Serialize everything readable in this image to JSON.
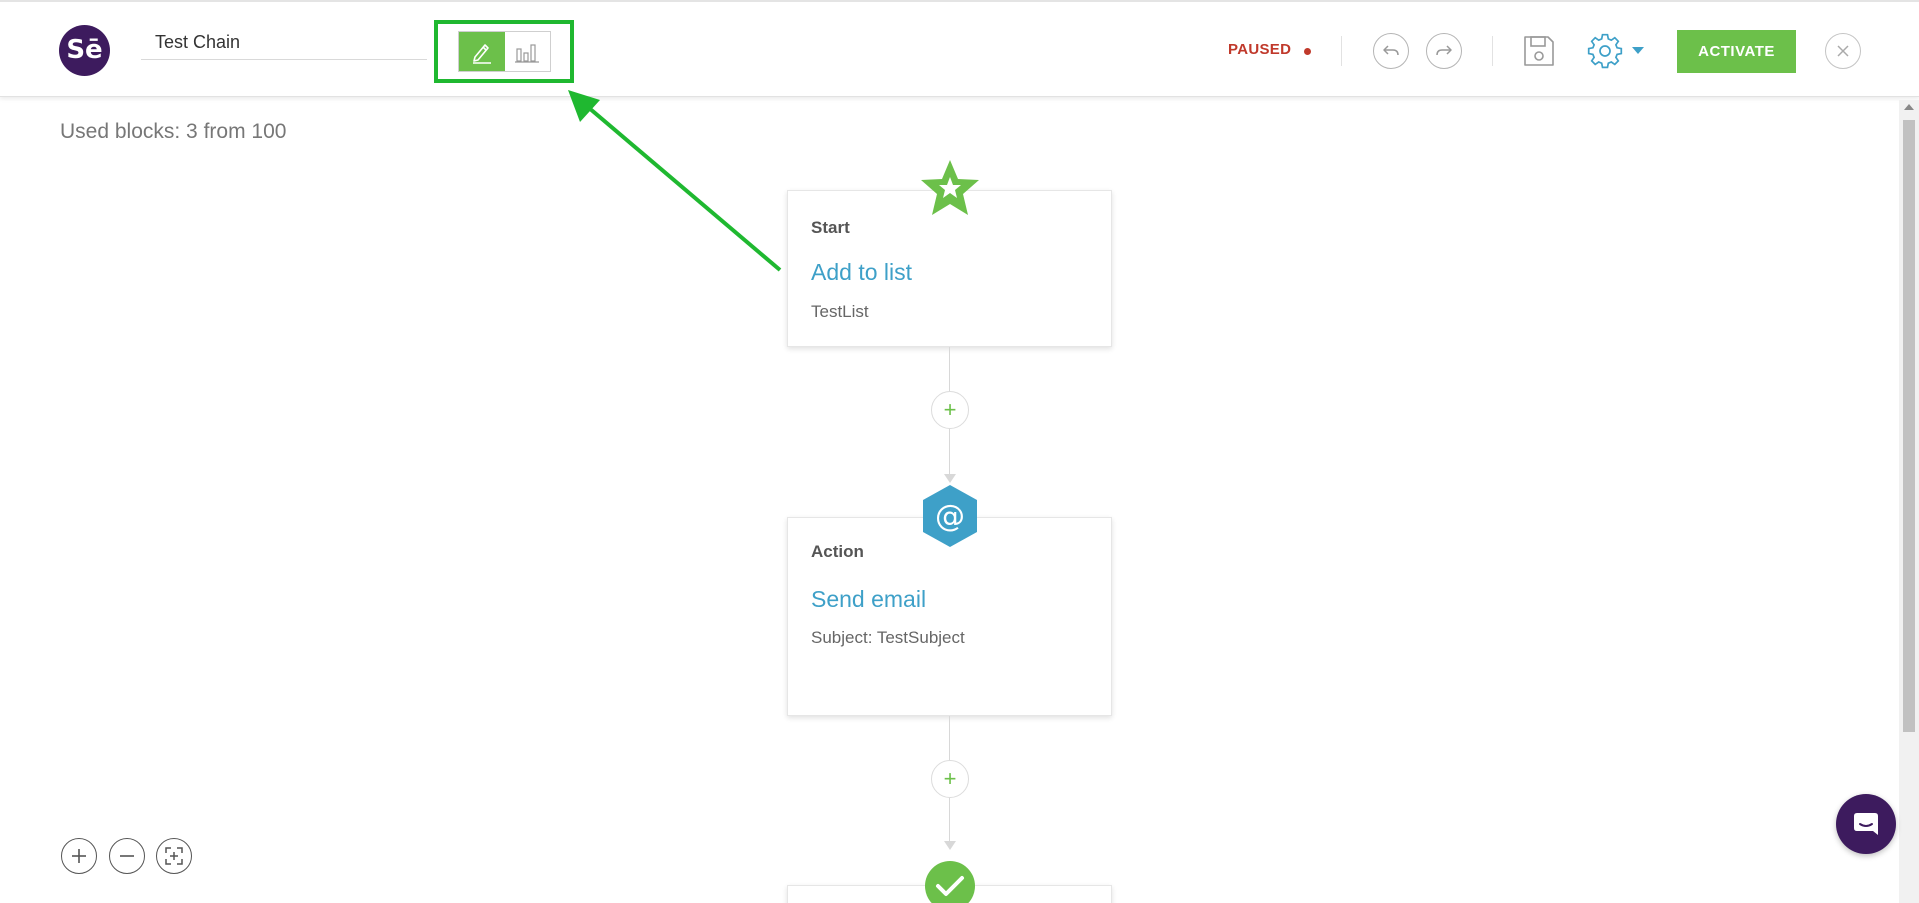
{
  "app": {
    "logo_text": "Sē",
    "chain_name": "Test Chain",
    "status": "PAUSED",
    "activate_label": "ACTIVATE",
    "colors": {
      "brand": "#3d1b5e",
      "accent_green": "#6cc04a",
      "link_blue": "#3ea0c8",
      "status_red": "#c0392b",
      "annotation_green": "#1fb830"
    }
  },
  "toolbar": {
    "mode_edit_icon": "pencil-icon",
    "mode_stats_icon": "bar-chart-icon",
    "undo_icon": "undo-icon",
    "redo_icon": "redo-icon",
    "save_icon": "save-icon",
    "settings_icon": "gear-icon",
    "close_icon": "close-icon"
  },
  "canvas": {
    "used_blocks": "Used blocks: 3 from 100",
    "blocks": [
      {
        "type": "Start",
        "title": "Add to list",
        "detail": "TestList",
        "badge_icon": "star-icon"
      },
      {
        "type": "Action",
        "title": "Send email",
        "detail": "Subject: TestSubject",
        "badge_icon": "at-sign-icon"
      },
      {
        "badge_icon": "checkmark-icon"
      }
    ],
    "add_label": "+"
  },
  "zoom": {
    "zoom_in_icon": "zoom-in-icon",
    "zoom_out_icon": "zoom-out-icon",
    "fit_icon": "fit-screen-icon"
  },
  "chat_icon": "chat-icon"
}
